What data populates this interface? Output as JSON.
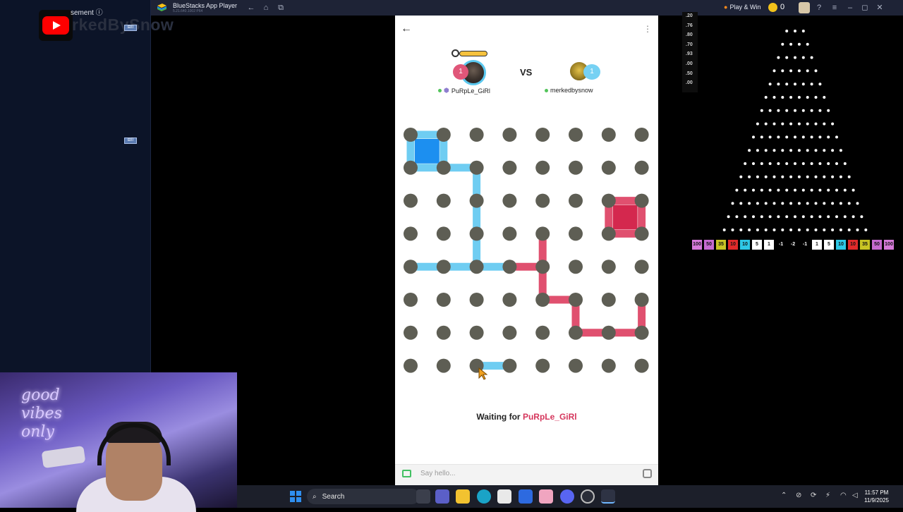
{
  "stream_overlay": {
    "ad_label": "sement",
    "info_icon": "info-icon",
    "channel_name": "rkedBySnow",
    "badge_a": "⊟⌷",
    "badge_b": "⊟⌷"
  },
  "bluestacks": {
    "title": "BlueStacks App Player",
    "version": "5.21.640.1002  P64",
    "play_win_label": "Play & Win",
    "coin_count": "0"
  },
  "game": {
    "player1": {
      "name": "PuRpLe_GiRl",
      "score": "1",
      "color": "#e05679"
    },
    "player2": {
      "name": "merkedbysnow",
      "score": "1",
      "color": "#76d1f3"
    },
    "vs_label": "VS",
    "status_prefix": "Waiting for",
    "status_player": "PuRpLe_GiRl",
    "chat_placeholder": "Say hello...",
    "grid": {
      "cols": 8,
      "rows": 8
    },
    "blue_lines": [
      [
        [
          0,
          0
        ],
        [
          1,
          0
        ]
      ],
      [
        [
          0,
          0
        ],
        [
          0,
          1
        ]
      ],
      [
        [
          1,
          0
        ],
        [
          1,
          1
        ]
      ],
      [
        [
          0,
          1
        ],
        [
          1,
          1
        ]
      ],
      [
        [
          1,
          1
        ],
        [
          2,
          1
        ]
      ],
      [
        [
          2,
          1
        ],
        [
          2,
          2
        ]
      ],
      [
        [
          2,
          2
        ],
        [
          2,
          3
        ]
      ],
      [
        [
          2,
          3
        ],
        [
          2,
          4
        ]
      ],
      [
        [
          0,
          4
        ],
        [
          1,
          4
        ]
      ],
      [
        [
          1,
          4
        ],
        [
          2,
          4
        ]
      ],
      [
        [
          2,
          4
        ],
        [
          3,
          4
        ]
      ],
      [
        [
          2,
          7
        ],
        [
          3,
          7
        ]
      ]
    ],
    "red_lines": [
      [
        [
          6,
          2
        ],
        [
          7,
          2
        ]
      ],
      [
        [
          6,
          2
        ],
        [
          6,
          3
        ]
      ],
      [
        [
          7,
          2
        ],
        [
          7,
          3
        ]
      ],
      [
        [
          6,
          3
        ],
        [
          7,
          3
        ]
      ],
      [
        [
          3,
          4
        ],
        [
          4,
          4
        ]
      ],
      [
        [
          4,
          3
        ],
        [
          4,
          4
        ]
      ],
      [
        [
          4,
          4
        ],
        [
          4,
          5
        ]
      ],
      [
        [
          4,
          5
        ],
        [
          5,
          5
        ]
      ],
      [
        [
          5,
          5
        ],
        [
          5,
          6
        ]
      ],
      [
        [
          5,
          6
        ],
        [
          6,
          6
        ]
      ],
      [
        [
          6,
          6
        ],
        [
          7,
          6
        ]
      ],
      [
        [
          7,
          5
        ],
        [
          7,
          6
        ]
      ]
    ],
    "blue_boxes": [
      [
        0,
        0
      ]
    ],
    "red_boxes": [
      [
        6,
        2
      ]
    ],
    "line_colors": {
      "blue": "#6fcdf2",
      "red": "#e0506f"
    },
    "box_colors": {
      "blue": "#1c8ff0",
      "red": "#d4284e"
    }
  },
  "multipliers_column": [
    ".20",
    ".76",
    ".80",
    ".70",
    ".93",
    ".00",
    ".50",
    ".00"
  ],
  "plinko": {
    "slots": [
      {
        "label": "100",
        "color": "#d57ad9"
      },
      {
        "label": "50",
        "color": "#c66ad0"
      },
      {
        "label": "35",
        "color": "#c8c424"
      },
      {
        "label": "10",
        "color": "#e02a2a"
      },
      {
        "label": "10",
        "color": "#2ec8e6"
      },
      {
        "label": "5",
        "color": "#ffffff"
      },
      {
        "label": "1",
        "color": "#ffffff"
      },
      {
        "label": "-1",
        "color": "#000000"
      },
      {
        "label": "-2",
        "color": "#000000"
      },
      {
        "label": "-1",
        "color": "#000000"
      },
      {
        "label": "1",
        "color": "#ffffff"
      },
      {
        "label": "5",
        "color": "#ffffff"
      },
      {
        "label": "10",
        "color": "#2ec8e6"
      },
      {
        "label": "10",
        "color": "#e02a2a"
      },
      {
        "label": "35",
        "color": "#c8c424"
      },
      {
        "label": "50",
        "color": "#c66ad0"
      },
      {
        "label": "100",
        "color": "#d57ad9"
      }
    ]
  },
  "webcam": {
    "neon_text": "good vibes only"
  },
  "taskbar": {
    "search_label": "Search",
    "time": "11:57 PM",
    "date": "11/9/2025"
  }
}
